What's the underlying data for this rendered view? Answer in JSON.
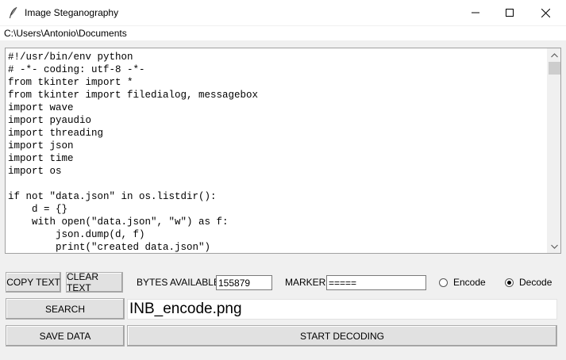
{
  "window": {
    "title": "Image Steganography",
    "path": "C:\\Users\\Antonio\\Documents"
  },
  "editor": {
    "lines": [
      "#!/usr/bin/env python",
      "# -*- coding: utf-8 -*-",
      "from tkinter import *",
      "from tkinter import filedialog, messagebox",
      "import wave",
      "import pyaudio",
      "import threading",
      "import json",
      "import time",
      "import os",
      "",
      "if not \"data.json\" in os.listdir():",
      "    d = {}",
      "    with open(\"data.json\", \"w\") as f:",
      "        json.dump(d, f)",
      "        print(\"created data.json\")"
    ]
  },
  "controls": {
    "copy_label": "COPY TEXT",
    "clear_label": "CLEAR TEXT",
    "bytes_label": "BYTES AVAILABLE:",
    "bytes_value": "155879",
    "marker_label": "MARKER:",
    "marker_value": "=====",
    "encode_label": "Encode",
    "decode_label": "Decode",
    "selected_mode": "Decode",
    "search_label": "SEARCH",
    "filename_value": "INB_encode.png",
    "save_label": "SAVE DATA",
    "start_label": "START DECODING"
  }
}
